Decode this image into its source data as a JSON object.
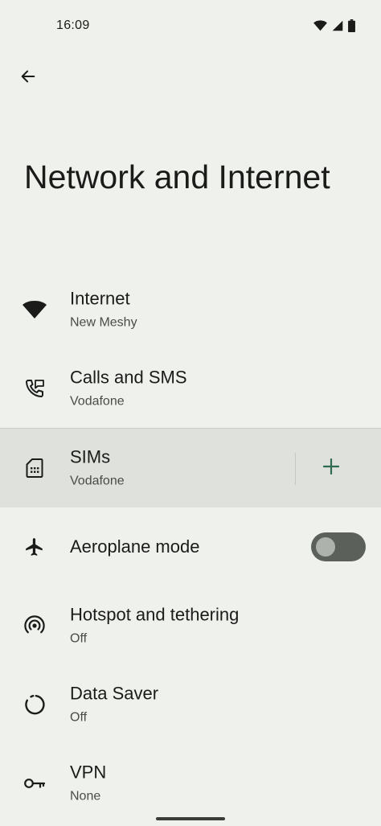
{
  "status_bar": {
    "time": "16:09",
    "icons": [
      "wifi-icon",
      "cell-signal-icon",
      "battery-icon"
    ]
  },
  "header": {
    "back_icon": "arrow-back-icon",
    "title": "Network and Internet"
  },
  "items": [
    {
      "id": "internet",
      "icon": "wifi-icon",
      "title": "Internet",
      "subtitle": "New Meshy"
    },
    {
      "id": "calls-sms",
      "icon": "calls-sms-icon",
      "title": "Calls and SMS",
      "subtitle": "Vodafone"
    },
    {
      "id": "sims",
      "icon": "sim-card-icon",
      "title": "SIMs",
      "subtitle": "Vodafone",
      "action_icon": "add-icon"
    },
    {
      "id": "aeroplane-mode",
      "icon": "airplane-icon",
      "title": "Aeroplane mode",
      "toggle_on": false
    },
    {
      "id": "hotspot",
      "icon": "hotspot-icon",
      "title": "Hotspot and tethering",
      "subtitle": "Off"
    },
    {
      "id": "data-saver",
      "icon": "data-saver-icon",
      "title": "Data Saver",
      "subtitle": "Off"
    },
    {
      "id": "vpn",
      "icon": "vpn-key-icon",
      "title": "VPN",
      "subtitle": "None"
    }
  ],
  "colors": {
    "background": "#eff1ed",
    "highlight": "#dfe1dd",
    "accent": "#2f6b4f",
    "toggle_track": "#5c605b",
    "toggle_thumb": "#aeb2ad"
  }
}
